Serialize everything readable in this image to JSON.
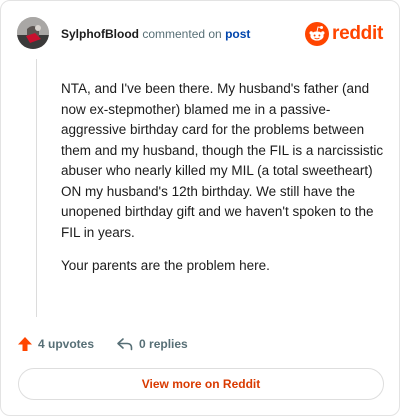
{
  "header": {
    "username": "SylphofBlood",
    "action_text": "commented on",
    "post_link": "post",
    "brand": "reddit"
  },
  "comment": {
    "paragraphs": [
      "NTA, and I've been there. My husband's father (and now ex-stepmother) blamed me in a passive-aggressive birthday card for the problems between them and my husband, though the FIL is a narcissistic abuser who nearly killed my MIL (a total sweetheart) ON my husband's 12th birthday. We still have the unopened birthday gift and we haven't spoken to the FIL in years.",
      "Your parents are the problem here."
    ]
  },
  "actions": {
    "upvotes": "4 upvotes",
    "replies": "0 replies"
  },
  "footer": {
    "view_more": "View more on Reddit"
  },
  "colors": {
    "brand": "#ff4500",
    "upvote": "#ff4500",
    "link": "#0045ac"
  },
  "icons": {
    "brand": "reddit-snoo-icon",
    "upvote": "upvote-arrow-icon",
    "reply": "reply-arrow-icon"
  }
}
